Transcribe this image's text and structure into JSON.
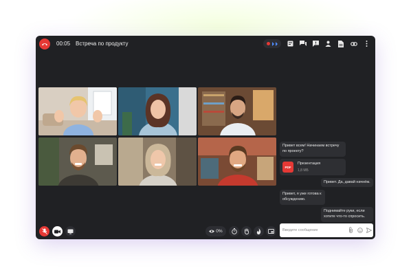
{
  "call": {
    "timer": "00:05",
    "title": "Встреча по продукту"
  },
  "chat": {
    "messages": [
      {
        "text": "Привет всем! Начинаем встречу по проекту?"
      },
      {
        "text": "Привет. Да, давай начнём."
      },
      {
        "text": "Привет, я уже готова к обсуждению."
      },
      {
        "text": "Поднимайте руки, если хотите что-то спросить."
      }
    ],
    "file": {
      "badge": "PDF",
      "name": "Презентация",
      "size": "1,8 МБ"
    },
    "input_placeholder": "Введите сообщение"
  },
  "controls": {
    "view_percent": "0%"
  },
  "colors": {
    "end_call": "#e53935",
    "window_bg": "#202124",
    "bubble_bg": "#2e2f33"
  }
}
